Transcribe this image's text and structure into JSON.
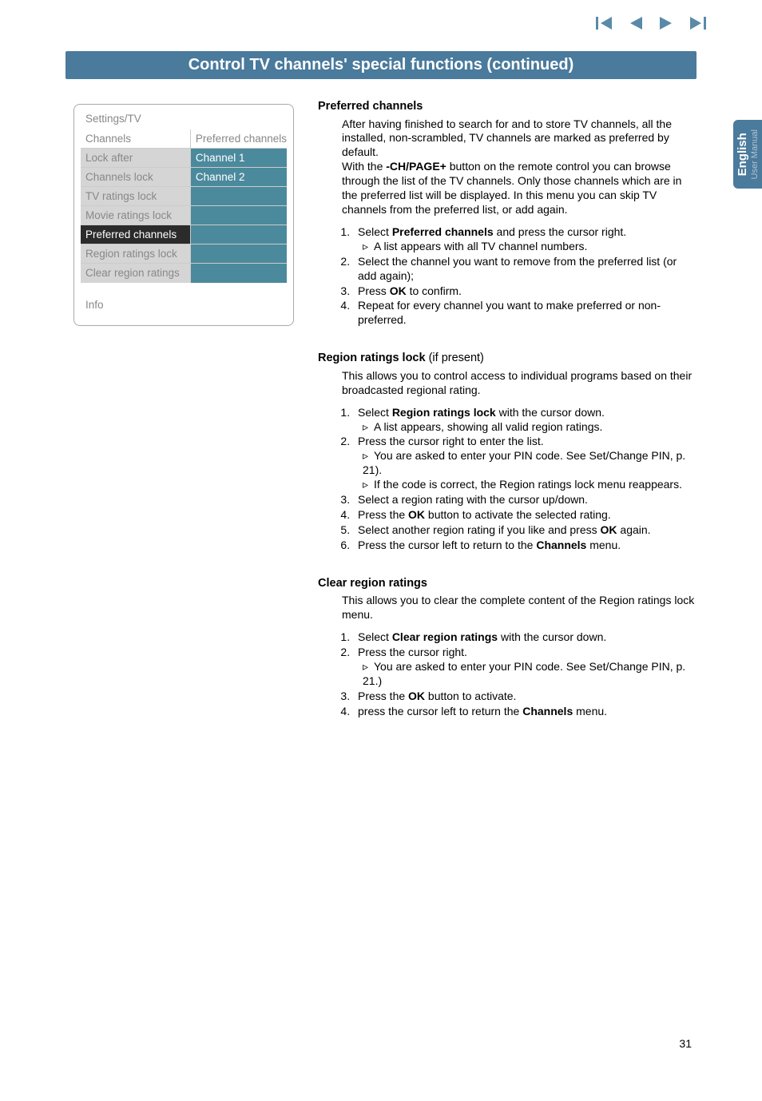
{
  "banner": "Control TV channels' special functions  (continued)",
  "sideTab": {
    "english": "English",
    "userManual": "User Manual"
  },
  "settings": {
    "title": "Settings/TV",
    "leftHeader": "Channels",
    "rightHeader": "Preferred channels",
    "leftRows": [
      "Lock after",
      "Channels lock",
      "TV ratings lock",
      "Movie ratings lock",
      "Preferred channels",
      "Region ratings lock",
      "Clear region ratings"
    ],
    "rightRows": [
      "Channel 1",
      "Channel 2",
      "",
      "",
      "",
      "",
      ""
    ],
    "info": "Info"
  },
  "pref": {
    "heading": "Preferred channels",
    "p1a": "After having finished to search for and to store TV channels, all the installed, non-scrambled, TV channels are marked as preferred by default.",
    "p1b_pre": "With the ",
    "p1b_bold": "-CH/PAGE+",
    "p1b_post": " button on the remote control you can browse through the list of the TV channels. Only those channels which are in the preferred list will be displayed. In this menu you can skip TV channels from the preferred list, or add again.",
    "li1_pre": "Select ",
    "li1_bold": "Preferred channels",
    "li1_post": " and press the cursor right.",
    "li1_sub": "A list appears with all TV channel numbers.",
    "li2": "Select the channel you want to remove from the preferred list (or add again);",
    "li3_pre": "Press ",
    "li3_bold": "OK",
    "li3_post": " to confirm.",
    "li4": "Repeat for every channel you want to make preferred or non-preferred."
  },
  "region": {
    "heading": "Region ratings lock",
    "suffix": "  (if present)",
    "p1": "This allows you to control access to individual programs based on their broadcasted regional rating.",
    "li1_pre": "Select ",
    "li1_bold": "Region ratings lock",
    "li1_post": " with the cursor down.",
    "li1_sub": "A list appears, showing all valid region ratings.",
    "li2": "Press the cursor right to enter the list.",
    "li2_sub1": "You are asked to enter your PIN code. See Set/Change PIN, p. 21).",
    "li2_sub2": "If the code is correct, the Region ratings lock menu reappears.",
    "li3": "Select a region rating with the cursor up/down.",
    "li4_pre": "Press the ",
    "li4_bold": "OK",
    "li4_post": " button to activate the selected rating.",
    "li5_pre": "Select another region rating if you like and press ",
    "li5_bold": "OK",
    "li5_post": " again.",
    "li6_pre": "Press the cursor left to return to the ",
    "li6_bold": "Channels",
    "li6_post": " menu."
  },
  "clear": {
    "heading": "Clear region ratings",
    "p1": "This allows you to clear the complete content of the Region ratings lock menu.",
    "li1_pre": "Select ",
    "li1_bold": "Clear region ratings",
    "li1_post": " with the cursor down.",
    "li2": "Press the cursor right.",
    "li2_sub": "You are asked to enter your PIN code. See Set/Change PIN, p. 21.)",
    "li3_pre": "Press the ",
    "li3_bold": "OK",
    "li3_post": " button to activate.",
    "li4_pre": "press the cursor left to return the ",
    "li4_bold": "Channels",
    "li4_post": " menu."
  },
  "pageNum": "31"
}
